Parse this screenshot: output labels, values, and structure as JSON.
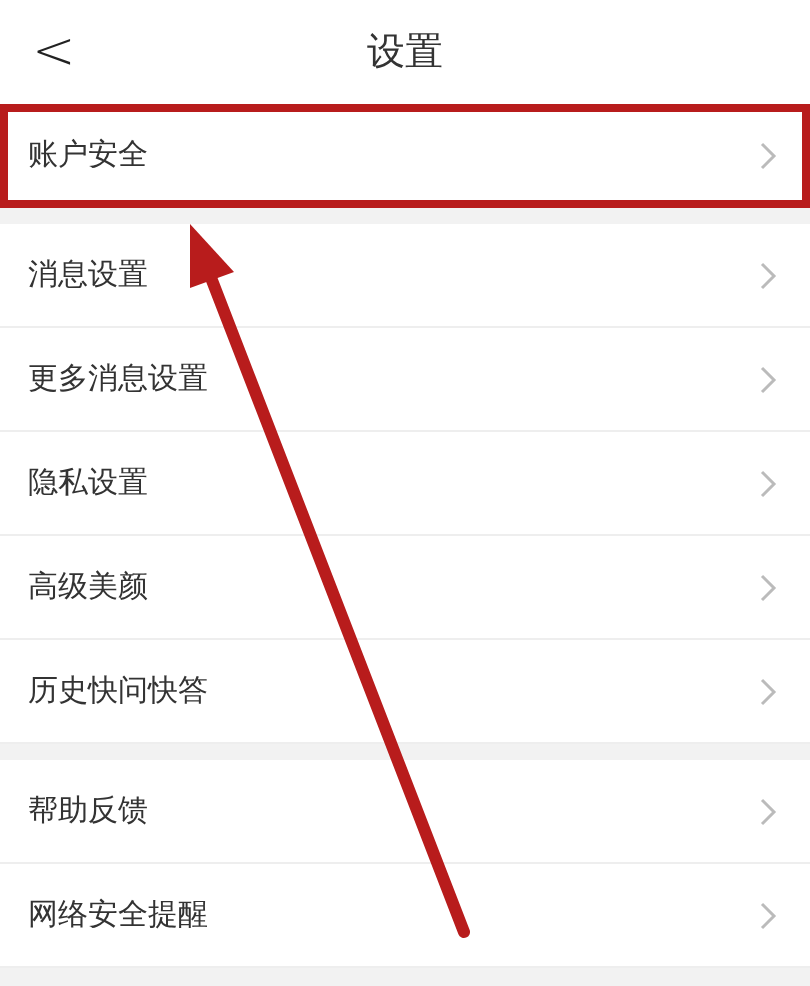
{
  "header": {
    "back": "<",
    "title": "设置"
  },
  "groups": [
    {
      "items": [
        {
          "label": "账户安全",
          "highlighted": true
        }
      ]
    },
    {
      "items": [
        {
          "label": "消息设置",
          "highlighted": false
        },
        {
          "label": "更多消息设置",
          "highlighted": false
        },
        {
          "label": "隐私设置",
          "highlighted": false
        },
        {
          "label": "高级美颜",
          "highlighted": false
        },
        {
          "label": "历史快问快答",
          "highlighted": false
        }
      ]
    },
    {
      "items": [
        {
          "label": "帮助反馈",
          "highlighted": false
        },
        {
          "label": "网络安全提醒",
          "highlighted": false
        }
      ]
    }
  ]
}
